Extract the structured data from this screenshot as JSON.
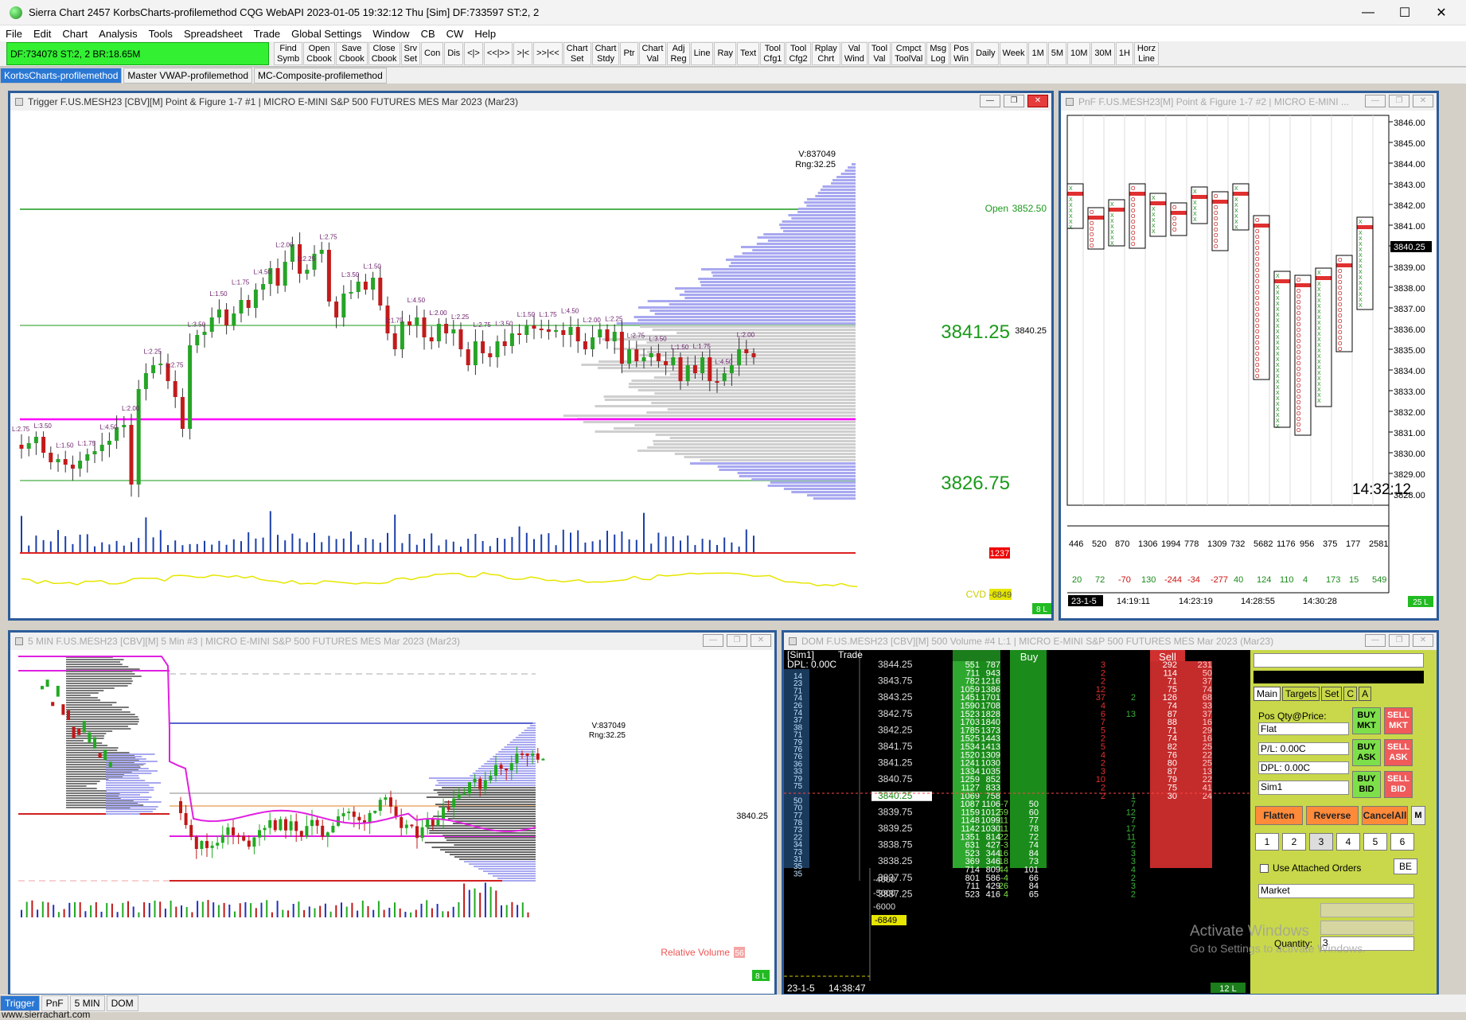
{
  "titlebar": {
    "title": "Sierra Chart 2457 KorbsCharts-profilemethod  CQG WebAPI 2023-01-05  19:32:12 Thu [Sim]  DF:733597  ST:2, 2",
    "minimize": "—",
    "maximize": "☐",
    "close": "✕"
  },
  "menu": [
    "File",
    "Edit",
    "Chart",
    "Analysis",
    "Tools",
    "Spreadsheet",
    "Trade",
    "Global Settings",
    "Window",
    "CB",
    "CW",
    "Help"
  ],
  "toolbar": {
    "status": "DF:734078  ST:2, 2  BR:18.65M",
    "buttons": [
      "Find\nSymb",
      "Open\nCbook",
      "Save\nCbook",
      "Close\nCbook",
      "Srv\nSet",
      "Con",
      "Dis",
      "<|>",
      "<<|>>",
      ">|<",
      ">>|<<",
      "Chart\nSet",
      "Chart\nStdy",
      "Ptr",
      "Chart\nVal",
      "Adj\nReg",
      "Line",
      "Ray",
      "Text",
      "Tool\nCfg1",
      "Tool\nCfg2",
      "Rplay\nChrt",
      "Val\nWind",
      "Tool\nVal",
      "Cmpct\nToolVal",
      "Msg\nLog",
      "Pos\nWin",
      "Daily",
      "Week",
      "1M",
      "5M",
      "10M",
      "30M",
      "1H",
      "Horz\nLine"
    ]
  },
  "chartbook_tabs": [
    "KorbsCharts-profilemethod",
    "Master VWAP-profilemethod",
    "MC-Composite-profilemethod"
  ],
  "win1": {
    "title": "Trigger F.US.MESH23 [CBV][M]  Point & Figure 1-7  #1 | MICRO E-MINI S&P 500 FUTURES MES Mar 2023 (Mar23)",
    "vinfo": "V:837049",
    "rng": "Rng:32.25",
    "open_label": "Open",
    "open_val": "3852.50",
    "p1": "3841.25",
    "p1b": "3840.25",
    "p2": "3826.75",
    "vol_badge": "1237",
    "cvd_label": "CVD",
    "cvd_val": "-6849",
    "bars_badge": "8 L",
    "colors": {
      "bull": "#26a426",
      "bear": "#c21b1b",
      "vwap": "#ff00ff",
      "profile_hi": "#a8a8f0",
      "profile": "#cfcfcf"
    }
  },
  "win2": {
    "title": "PnF F.US.MESH23[M]  Point & Figure 1-7  #2 | MICRO E-MINI ...",
    "prices": [
      "3846.00",
      "3845.00",
      "3844.00",
      "3843.00",
      "3842.00",
      "3841.00",
      "3840.25",
      "3839.00",
      "3838.00",
      "3837.00",
      "3836.00",
      "3835.00",
      "3834.00",
      "3833.00",
      "3832.00",
      "3831.00",
      "3830.00",
      "3829.00",
      "3828.00"
    ],
    "clock": "14:32:12",
    "vol_row": [
      "446",
      "520",
      "870",
      "1306",
      "1994",
      "778",
      "1309",
      "732",
      "5682",
      "1176",
      "956",
      "375",
      "177",
      "2581"
    ],
    "delta_row": [
      "20",
      "72",
      "-70",
      "130",
      "-244",
      "-34",
      "-277",
      "40",
      "124",
      "110",
      "4",
      "173",
      "15",
      "549"
    ],
    "times": [
      "23-1-5",
      "14:19:11",
      "14:23:19",
      "14:28:55",
      "14:30:28"
    ],
    "badge": "25 L"
  },
  "win3": {
    "title": "5 MIN F.US.MESH23 [CBV][M]  5 Min   #3 | MICRO E-MINI S&P 500 FUTURES MES Mar 2023 (Mar23)",
    "vinfo": "V:837049",
    "rng": "Rng:32.25",
    "price": "3840.25",
    "relvol_label": "Relative Volume",
    "relvol_val": "56",
    "badge": "8 L"
  },
  "win4": {
    "title": "DOM F.US.MESH23 [CBV][M]  500 Volume  #4 L:1 | MICRO E-MINI S&P 500 FUTURES MES Mar 2023 (Mar23)",
    "hdr_sim": "[Sim1]",
    "hdr_trade": "Trade",
    "dpl": "DPL: 0.00C",
    "buy": "Buy",
    "sell": "Sell",
    "ladder": [
      {
        "p": "3844.25",
        "a": "551",
        "b": "787",
        "s": "3",
        "sv": "292",
        "sr": "231"
      },
      {
        "p": "",
        "a": "711",
        "b": "943",
        "s": "2",
        "sv": "114",
        "sr": "50"
      },
      {
        "p": "3843.75",
        "a": "782",
        "b": "1216",
        "s": "2",
        "sv": "71",
        "sr": "37"
      },
      {
        "p": "",
        "a": "1059",
        "b": "1386",
        "s": "12",
        "sv": "75",
        "sr": "74"
      },
      {
        "p": "3843.25",
        "a": "1451",
        "b": "1701",
        "s": "37",
        "sv": "126",
        "sr": "68",
        "x": "2"
      },
      {
        "p": "",
        "a": "1590",
        "b": "1708",
        "s": "4",
        "sv": "74",
        "sr": "33"
      },
      {
        "p": "3842.75",
        "a": "1523",
        "b": "1828",
        "s": "6",
        "sv": "87",
        "sr": "37",
        "x": "13"
      },
      {
        "p": "",
        "a": "1703",
        "b": "1840",
        "s": "7",
        "sv": "88",
        "sr": "16"
      },
      {
        "p": "3842.25",
        "a": "1785",
        "b": "1373",
        "s": "5",
        "sv": "71",
        "sr": "29"
      },
      {
        "p": "",
        "a": "1525",
        "b": "1443",
        "s": "2",
        "sv": "74",
        "sr": "16"
      },
      {
        "p": "3841.75",
        "a": "1534",
        "b": "1413",
        "s": "5",
        "sv": "82",
        "sr": "25"
      },
      {
        "p": "",
        "a": "1520",
        "b": "1309",
        "s": "4",
        "sv": "76",
        "sr": "22"
      },
      {
        "p": "3841.25",
        "a": "1241",
        "b": "1030",
        "s": "2",
        "sv": "80",
        "sr": "25"
      },
      {
        "p": "",
        "a": "1334",
        "b": "1035",
        "s": "3",
        "sv": "87",
        "sr": "13"
      },
      {
        "p": "3840.75",
        "a": "1259",
        "b": "852",
        "s": "10",
        "sv": "79",
        "sr": "22"
      },
      {
        "p": "",
        "a": "1127",
        "b": "833",
        "s": "2",
        "sv": "75",
        "sr": "41"
      },
      {
        "p": "3840.25",
        "a": "1069",
        "b": "758",
        "s": "2",
        "sv": "30",
        "sr": "24",
        "x": "1"
      },
      {
        "p": "",
        "a": "1087",
        "b": "1106",
        "c": "-7",
        "bv": "50",
        "x": "7"
      },
      {
        "p": "3839.75",
        "a": "1159",
        "b": "1012",
        "c": "59",
        "bv": "60",
        "x": "12"
      },
      {
        "p": "",
        "a": "1148",
        "b": "1099",
        "c": "11",
        "bv": "77",
        "x": "7"
      },
      {
        "p": "3839.25",
        "a": "1142",
        "b": "1030",
        "c": "11",
        "bv": "78",
        "x": "17"
      },
      {
        "p": "",
        "a": "1351",
        "b": "814",
        "c": "22",
        "bv": "72",
        "x": "11"
      },
      {
        "p": "3838.75",
        "a": "631",
        "b": "427",
        "c": "-3",
        "bv": "74",
        "x": "2"
      },
      {
        "p": "",
        "a": "523",
        "b": "344",
        "c": "16",
        "bv": "84",
        "x": "3"
      },
      {
        "p": "3838.25",
        "a": "369",
        "b": "346",
        "c": "18",
        "bv": "73",
        "x": "3"
      },
      {
        "p": "",
        "a": "714",
        "b": "809",
        "c": "44",
        "bv": "101",
        "x": "4"
      },
      {
        "p": "3837.75",
        "a": "801",
        "b": "586",
        "c": "-4",
        "bv": "66",
        "x": "2"
      },
      {
        "p": "",
        "a": "711",
        "b": "429",
        "c": "26",
        "bv": "84",
        "x": "3"
      },
      {
        "p": "3837.25",
        "a": "523",
        "b": "416",
        "c": "4",
        "bv": "65",
        "x": "2"
      }
    ],
    "leftcol": [
      "14",
      "23",
      "71",
      "74",
      "26",
      "74",
      "37",
      "38",
      "71",
      "79",
      "76",
      "76",
      "36",
      "33",
      "79",
      "75",
      "",
      "50",
      "70",
      "77",
      "78",
      "73",
      "22",
      "34",
      "73",
      "31",
      "35",
      "35"
    ],
    "axis": [
      "-4000",
      "-5000",
      "-6000",
      "-6849"
    ],
    "date": "23-1-5",
    "time": "14:38:47",
    "badge": "12 L"
  },
  "trade_panel": {
    "tabs": [
      "Main",
      "Targets",
      "Set",
      "C",
      "A"
    ],
    "posqty_label": "Pos Qty@Price:",
    "posqty": "Flat",
    "pl": "P/L: 0.00C",
    "dpl": "DPL: 0.00C",
    "account": "Sim1",
    "buy_mkt": "BUY\nMKT",
    "sell_mkt": "SELL\nMKT",
    "buy_ask": "BUY\nASK",
    "sell_ask": "SELL\nASK",
    "buy_bid": "BUY\nBID",
    "sell_bid": "SELL\nBID",
    "flatten": "Flatten",
    "reverse": "Reverse",
    "cancelall": "CancelAll",
    "m": "M",
    "qtys": [
      "1",
      "2",
      "3",
      "4",
      "5",
      "6"
    ],
    "attached": "Use Attached Orders",
    "be": "BE",
    "ordertype": "Market",
    "quantity_label": "Quantity:",
    "quantity": "3"
  },
  "watermark": {
    "line1": "Activate Windows",
    "line2": "Go to Settings to activate Windows."
  },
  "bottom_tabs": [
    "Trigger",
    "PnF",
    "5 MIN",
    "DOM"
  ],
  "footer": "www.sierrachart.com"
}
